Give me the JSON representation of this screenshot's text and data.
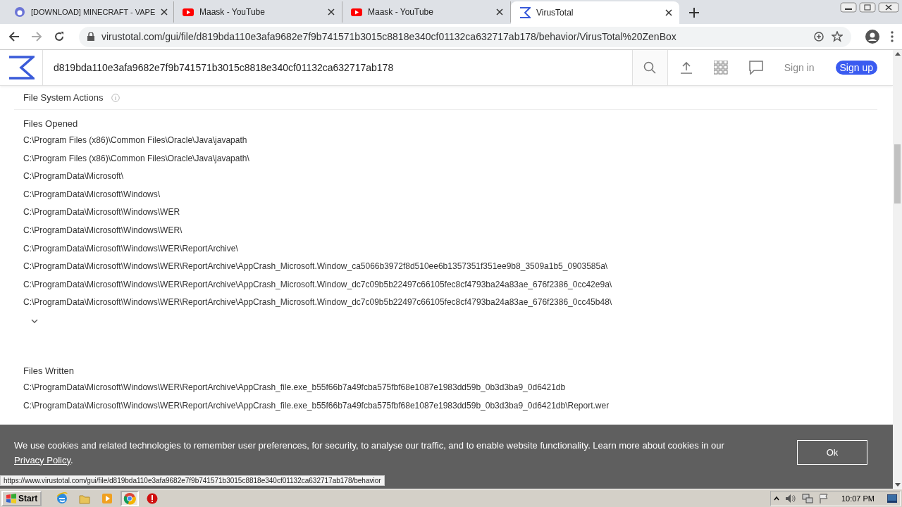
{
  "browser": {
    "tabs": [
      {
        "title": "[DOWNLOAD] MINECRAFT - VAPE",
        "kind": "ring",
        "selected": false
      },
      {
        "title": "Maask - YouTube",
        "kind": "play",
        "selected": false
      },
      {
        "title": "Maask - YouTube",
        "kind": "play",
        "selected": false
      },
      {
        "title": "VirusTotal",
        "kind": "sigma",
        "selected": true
      }
    ],
    "address": {
      "url": "virustotal.com/gui/file/d819bda110e3afa9682e7f9b741571b3015c8818e340cf01132ca632717ab178/behavior/VirusTotal%20ZenBox"
    }
  },
  "site": {
    "search_value": "d819bda110e3afa9682e7f9b741571b3015c8818e340cf01132ca632717ab178",
    "sign_in": "Sign in",
    "sign_up": "Sign up"
  },
  "section": {
    "title": "File System Actions",
    "groups": [
      {
        "title": "Files Opened",
        "expandable": true,
        "files": [
          "C:\\Program Files (x86)\\Common Files\\Oracle\\Java\\javapath",
          "C:\\Program Files (x86)\\Common Files\\Oracle\\Java\\javapath\\",
          "C:\\ProgramData\\Microsoft\\",
          "C:\\ProgramData\\Microsoft\\Windows\\",
          "C:\\ProgramData\\Microsoft\\Windows\\WER",
          "C:\\ProgramData\\Microsoft\\Windows\\WER\\",
          "C:\\ProgramData\\Microsoft\\Windows\\WER\\ReportArchive\\",
          "C:\\ProgramData\\Microsoft\\Windows\\WER\\ReportArchive\\AppCrash_Microsoft.Window_ca5066b3972f8d510ee6b1357351f351ee9b8_3509a1b5_0903585a\\",
          "C:\\ProgramData\\Microsoft\\Windows\\WER\\ReportArchive\\AppCrash_Microsoft.Window_dc7c09b5b22497c66105fec8cf4793ba24a83ae_676f2386_0cc42e9a\\",
          "C:\\ProgramData\\Microsoft\\Windows\\WER\\ReportArchive\\AppCrash_Microsoft.Window_dc7c09b5b22497c66105fec8cf4793ba24a83ae_676f2386_0cc45b48\\"
        ]
      },
      {
        "title": "Files Written",
        "expandable": false,
        "files": [
          "C:\\ProgramData\\Microsoft\\Windows\\WER\\ReportArchive\\AppCrash_file.exe_b55f66b7a49fcba575fbf68e1087e1983dd59b_0b3d3ba9_0d6421db",
          "C:\\ProgramData\\Microsoft\\Windows\\WER\\ReportArchive\\AppCrash_file.exe_b55f66b7a49fcba575fbf68e1087e1983dd59b_0b3d3ba9_0d6421db\\Report.wer"
        ]
      }
    ]
  },
  "cookie_banner": {
    "text": "We use cookies and related technologies to remember user preferences, for security, to analyse our traffic, and to enable website functionality. Learn more about cookies in our",
    "link": "Privacy Policy",
    "end": ".",
    "button": "Ok"
  },
  "status_url": "https://www.virustotal.com/gui/file/d819bda110e3afa9682e7f9b741571b3015c8818e340cf01132ca632717ab178/behavior",
  "taskbar": {
    "start": "Start",
    "apps": [
      {
        "kind": "ie",
        "selected": false
      },
      {
        "kind": "folder",
        "selected": false
      },
      {
        "kind": "media",
        "selected": false
      },
      {
        "kind": "chrome",
        "selected": true
      },
      {
        "kind": "stop",
        "selected": false
      }
    ],
    "clock": "10:07 PM"
  }
}
